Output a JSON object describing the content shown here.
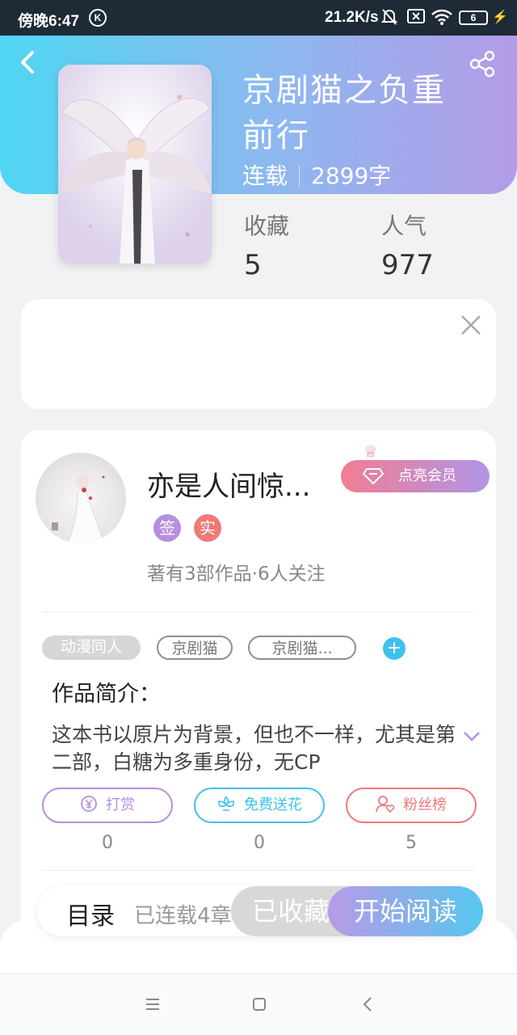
{
  "status_bar": {
    "time": "傍晚6:47",
    "k_badge": "K",
    "network_speed": "21.2K/s",
    "battery": "6",
    "icons": [
      "mute-bell-icon",
      "sim-x-icon",
      "wifi-icon",
      "battery-icon",
      "charging-bolt-icon"
    ]
  },
  "header": {
    "colors": {
      "gradient_start": "#4fd6f2",
      "gradient_end": "#b49be8"
    },
    "icons": {
      "back": "chevron-left-icon",
      "share": "share-icon"
    }
  },
  "book": {
    "title": "京剧猫之负重前行",
    "status": "连载",
    "word_count": "2899字",
    "stats": [
      {
        "label": "收藏",
        "value": "5"
      },
      {
        "label": "人气",
        "value": "977"
      }
    ]
  },
  "ad": {
    "close_icon": "close-icon"
  },
  "author": {
    "name": "亦是人间惊...",
    "vip_button": "点亮会员",
    "badges": [
      {
        "text": "签",
        "color": "#b68fe0"
      },
      {
        "text": "实",
        "color": "#f07878"
      }
    ],
    "stats": "著有3部作品·6人关注"
  },
  "tags": {
    "items": [
      "动漫同人",
      "京剧猫",
      "京剧猫..."
    ],
    "add": "+"
  },
  "intro": {
    "title": "作品简介：",
    "text": "这本书以原片为背景，但也不一样，尤其是第二部，白糖为多重身份，无CP"
  },
  "actions": [
    {
      "label": "打赏",
      "count": "0",
      "color": "#b68fe0",
      "icon": "yen-coin-icon"
    },
    {
      "label": "免费送花",
      "count": "0",
      "color": "#3fc1ec",
      "icon": "flower-icon"
    },
    {
      "label": "粉丝榜",
      "count": "5",
      "color": "#f07878",
      "icon": "fan-user-icon"
    }
  ],
  "bottom_bar": {
    "toc_label": "目录",
    "toc_status": "已连载4章",
    "collected_label": "已收藏",
    "read_label": "开始阅读"
  },
  "nav_bar": {
    "icons": [
      "menu-icon",
      "home-square-icon",
      "back-triangle-icon"
    ]
  }
}
